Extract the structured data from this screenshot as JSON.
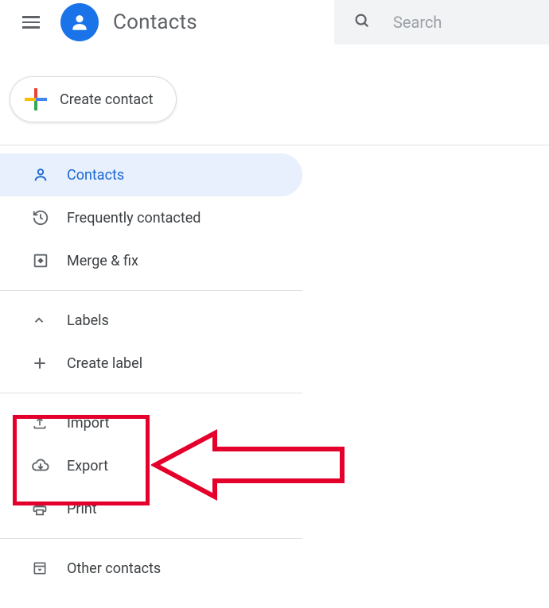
{
  "header": {
    "app_title": "Contacts",
    "search_placeholder": "Search"
  },
  "create_button": {
    "label": "Create contact"
  },
  "nav": {
    "contacts": "Contacts",
    "frequently": "Frequently contacted",
    "merge": "Merge & fix",
    "labels": "Labels",
    "create_label": "Create label",
    "import": "Import",
    "export": "Export",
    "print": "Print",
    "other": "Other contacts"
  },
  "icons": {
    "menu": "menu-icon",
    "avatar": "avatar-icon",
    "search": "search-icon",
    "plus": "plus-icon",
    "person": "person-icon",
    "history": "history-icon",
    "merge": "merge-icon",
    "chevron_up": "chevron-up-icon",
    "plus_small": "plus-small-icon",
    "upload": "upload-icon",
    "cloud_download": "cloud-download-icon",
    "print": "print-icon",
    "archive": "archive-icon"
  },
  "colors": {
    "primary": "#1a73e8",
    "active_bg": "#e8f0fe",
    "active_fg": "#1967d2",
    "grey": "#5f6368",
    "annotation_red": "#e4002b"
  }
}
